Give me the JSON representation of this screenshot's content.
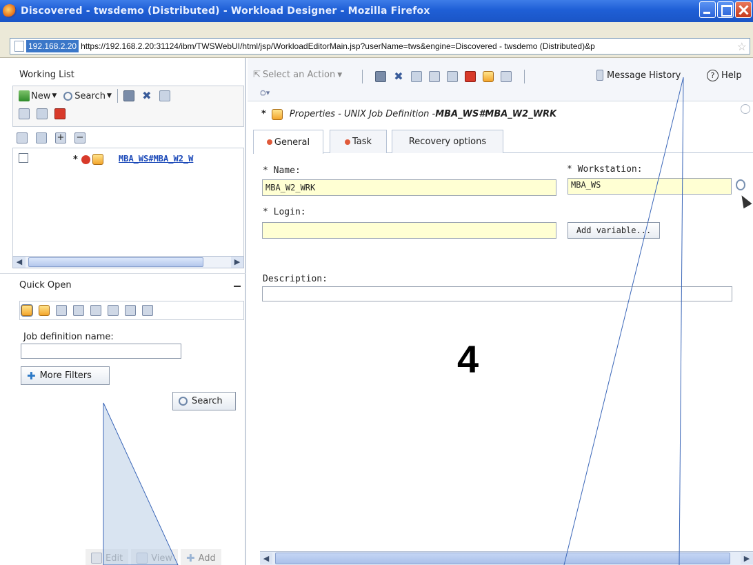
{
  "window": {
    "title": "Discovered - twsdemo (Distributed) - Workload Designer - Mozilla Firefox"
  },
  "urlbar": {
    "host": "192.168.2.20",
    "url": "https://192.168.2.20:31124/ibm/TWSWebUI/html/jsp/WorkloadEditorMain.jsp?userName=tws&engine=Discovered - twsdemo (Distributed)&p"
  },
  "working_list": {
    "title": "Working List",
    "new_label": "New",
    "search_label": "Search",
    "items": [
      {
        "marker": "*",
        "label": "MBA_WS#MBA_W2_W"
      }
    ]
  },
  "quick_open": {
    "title": "Quick Open",
    "field_label": "Job definition name:",
    "field_value": "",
    "more_filters_label": "More Filters",
    "search_label": "Search",
    "actions": [
      "Edit",
      "View",
      "Add"
    ]
  },
  "toolbar": {
    "select_action": "Select an Action",
    "message_history": "Message History",
    "help": "Help"
  },
  "properties": {
    "marker": "*",
    "title": "Properties - UNIX Job Definition - ",
    "job_name": "MBA_WS#MBA_W2_WRK"
  },
  "tabs": [
    "General",
    "Task",
    "Recovery options"
  ],
  "form": {
    "name_label": "* Name:",
    "name_value": "MBA_W2_WRK",
    "workstation_label": "* Workstation:",
    "workstation_value": "MBA_WS",
    "login_label": "* Login:",
    "login_value": "",
    "add_variable_label": "Add variable...",
    "description_label": "Description:",
    "description_value": ""
  },
  "annotation": {
    "step": "4"
  }
}
